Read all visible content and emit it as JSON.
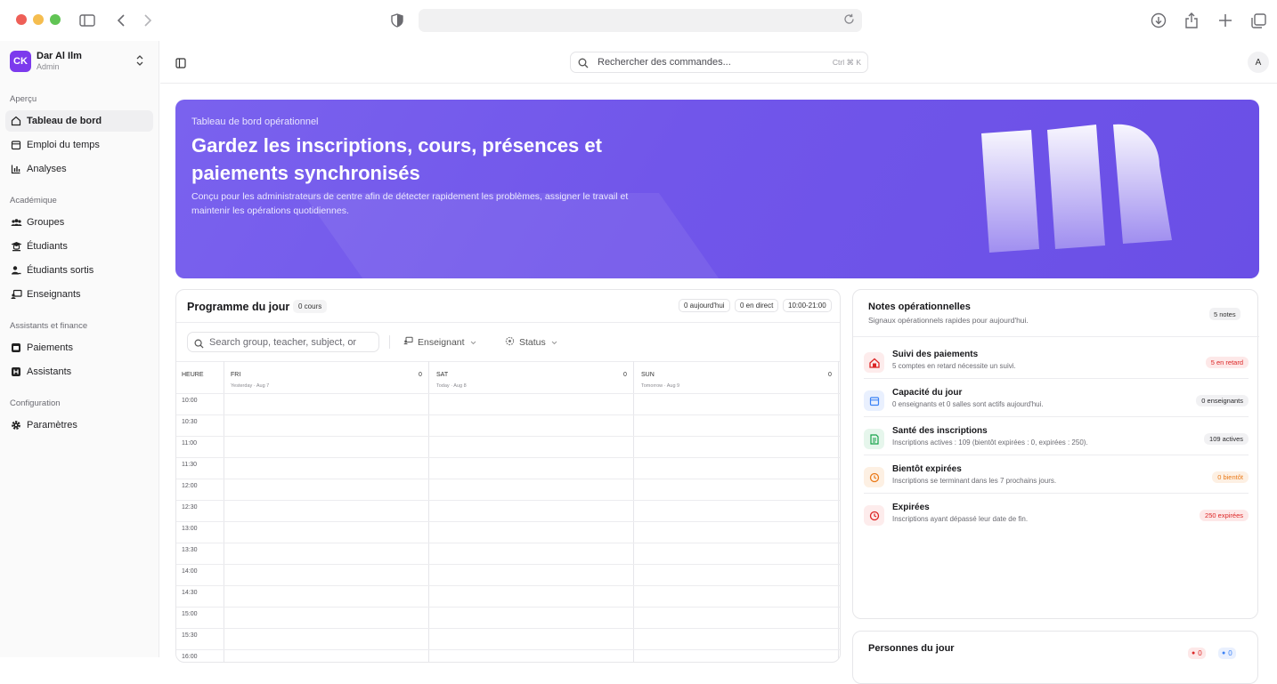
{
  "browser": {
    "url": ""
  },
  "workspace": {
    "initials": "CK",
    "name": "Dar Al Ilm",
    "role": "Admin"
  },
  "sidebar": {
    "sections": [
      {
        "title": "Aperçu",
        "items": [
          {
            "label": "Tableau de bord",
            "icon": "home-icon",
            "active": true
          },
          {
            "label": "Emploi du temps",
            "icon": "calendar-icon"
          },
          {
            "label": "Analyses",
            "icon": "bar-chart-icon"
          }
        ]
      },
      {
        "title": "Académique",
        "items": [
          {
            "label": "Groupes",
            "icon": "users-icon"
          },
          {
            "label": "Étudiants",
            "icon": "student-icon"
          },
          {
            "label": "Étudiants sortis",
            "icon": "user-minus-icon"
          },
          {
            "label": "Enseignants",
            "icon": "teacher-icon"
          }
        ]
      },
      {
        "title": "Assistants et finance",
        "items": [
          {
            "label": "Paiements",
            "icon": "payment-icon"
          },
          {
            "label": "Assistants",
            "icon": "assistant-icon"
          }
        ]
      },
      {
        "title": "Configuration",
        "items": [
          {
            "label": "Paramètres",
            "icon": "gear-icon"
          }
        ]
      }
    ]
  },
  "topbar": {
    "search_placeholder": "Rechercher des commandes...",
    "shortcut": "Ctrl ⌘ K",
    "user_initial": "A"
  },
  "hero": {
    "eyebrow": "Tableau de bord opérationnel",
    "title": "Gardez les inscriptions, cours, présences et paiements synchronisés",
    "description": "Conçu pour les administrateurs de centre afin de détecter rapidement les problèmes, assigner le travail et maintenir les opérations quotidiennes.",
    "accent": "#7156ea"
  },
  "programme": {
    "title": "Programme du jour",
    "count_badge": "0 cours",
    "today_badge": "0 aujourd'hui",
    "live_badge": "0 en direct",
    "hours_badge": "10:00-21:00",
    "search_placeholder": "Search group, teacher, subject, or",
    "filter_teacher": "Enseignant",
    "filter_status": "Status",
    "hour_header": "HEURE",
    "days": [
      {
        "name": "FRI",
        "sub": "Yesterday · Aug 7",
        "count": "0"
      },
      {
        "name": "SAT",
        "sub": "Today · Aug 8",
        "count": "0"
      },
      {
        "name": "SUN",
        "sub": "Tomorrow · Aug 9",
        "count": "0"
      }
    ],
    "times": [
      "10:00",
      "10:30",
      "11:00",
      "11:30",
      "12:00",
      "12:30",
      "13:00",
      "13:30",
      "14:00",
      "14:30",
      "15:00",
      "15:30",
      "16:00"
    ]
  },
  "notes": {
    "title": "Notes opérationnelles",
    "subtitle": "Signaux opérationnels rapides pour aujourd'hui.",
    "badge": "5 notes",
    "items": [
      {
        "title": "Suivi des paiements",
        "desc": "5 comptes en retard nécessite un suivi.",
        "badge": "5 en retard",
        "icon": "house-alert-icon",
        "icon_bg": "#fdecec",
        "icon_color": "#dc2626",
        "badge_bg": "#fde8e8",
        "badge_color": "#dc2626"
      },
      {
        "title": "Capacité du jour",
        "desc": "0 enseignants et 0 salles sont actifs aujourd'hui.",
        "badge": "0 enseignants",
        "icon": "calendar-icon",
        "icon_bg": "#e9f0fe",
        "icon_color": "#3b82f6",
        "badge_bg": "#f1f1f3",
        "badge_color": "#27272a"
      },
      {
        "title": "Santé des inscriptions",
        "desc": "Inscriptions actives : 109 (bientôt expirées : 0, expirées : 250).",
        "badge": "109 actives",
        "icon": "document-icon",
        "icon_bg": "#e6f6ec",
        "icon_color": "#16a34a",
        "badge_bg": "#f1f1f3",
        "badge_color": "#27272a"
      },
      {
        "title": "Bientôt expirées",
        "desc": "Inscriptions se terminant dans les 7 prochains jours.",
        "badge": "0 bientôt",
        "icon": "clock-alert-icon",
        "icon_bg": "#fdf0e3",
        "icon_color": "#ea7a1a",
        "badge_bg": "#fdf0e3",
        "badge_color": "#ea7a1a"
      },
      {
        "title": "Expirées",
        "desc": "Inscriptions ayant dépassé leur date de fin.",
        "badge": "250 expirées",
        "icon": "clock-x-icon",
        "icon_bg": "#fdecec",
        "icon_color": "#dc2626",
        "badge_bg": "#fde8e8",
        "badge_color": "#dc2626"
      }
    ]
  },
  "people": {
    "title": "Personnes du jour",
    "badge_a": "0",
    "badge_b": "0"
  }
}
